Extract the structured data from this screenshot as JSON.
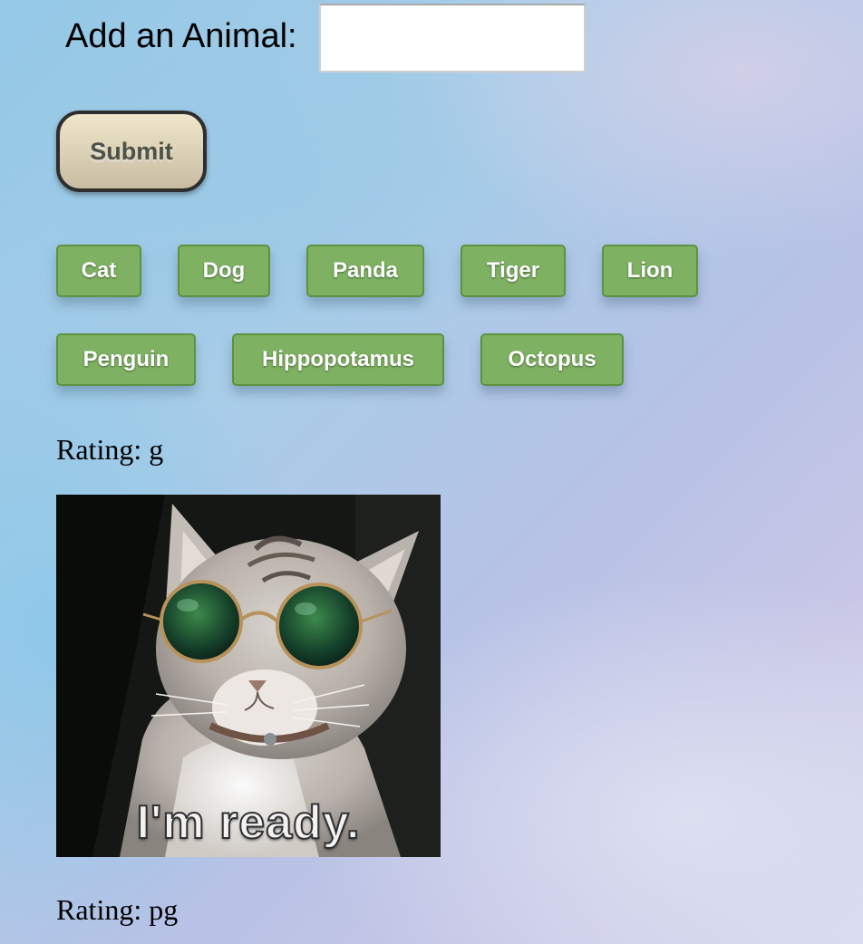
{
  "form": {
    "label": "Add an Animal:",
    "input_value": "",
    "input_placeholder": "",
    "submit_label": "Submit"
  },
  "animal_buttons": [
    {
      "label": "Cat"
    },
    {
      "label": "Dog"
    },
    {
      "label": "Panda"
    },
    {
      "label": "Tiger"
    },
    {
      "label": "Lion"
    },
    {
      "label": "Penguin"
    },
    {
      "label": "Hippopotamus"
    },
    {
      "label": "Octopus"
    }
  ],
  "results": [
    {
      "rating_prefix": "Rating: ",
      "rating": "g",
      "caption": "I'm ready."
    },
    {
      "rating_prefix": "Rating: ",
      "rating": "pg"
    }
  ],
  "colors": {
    "animal_button_bg": "#7eb162",
    "animal_button_border": "#5d9240",
    "submit_button_bg": "#e8dfc4"
  }
}
